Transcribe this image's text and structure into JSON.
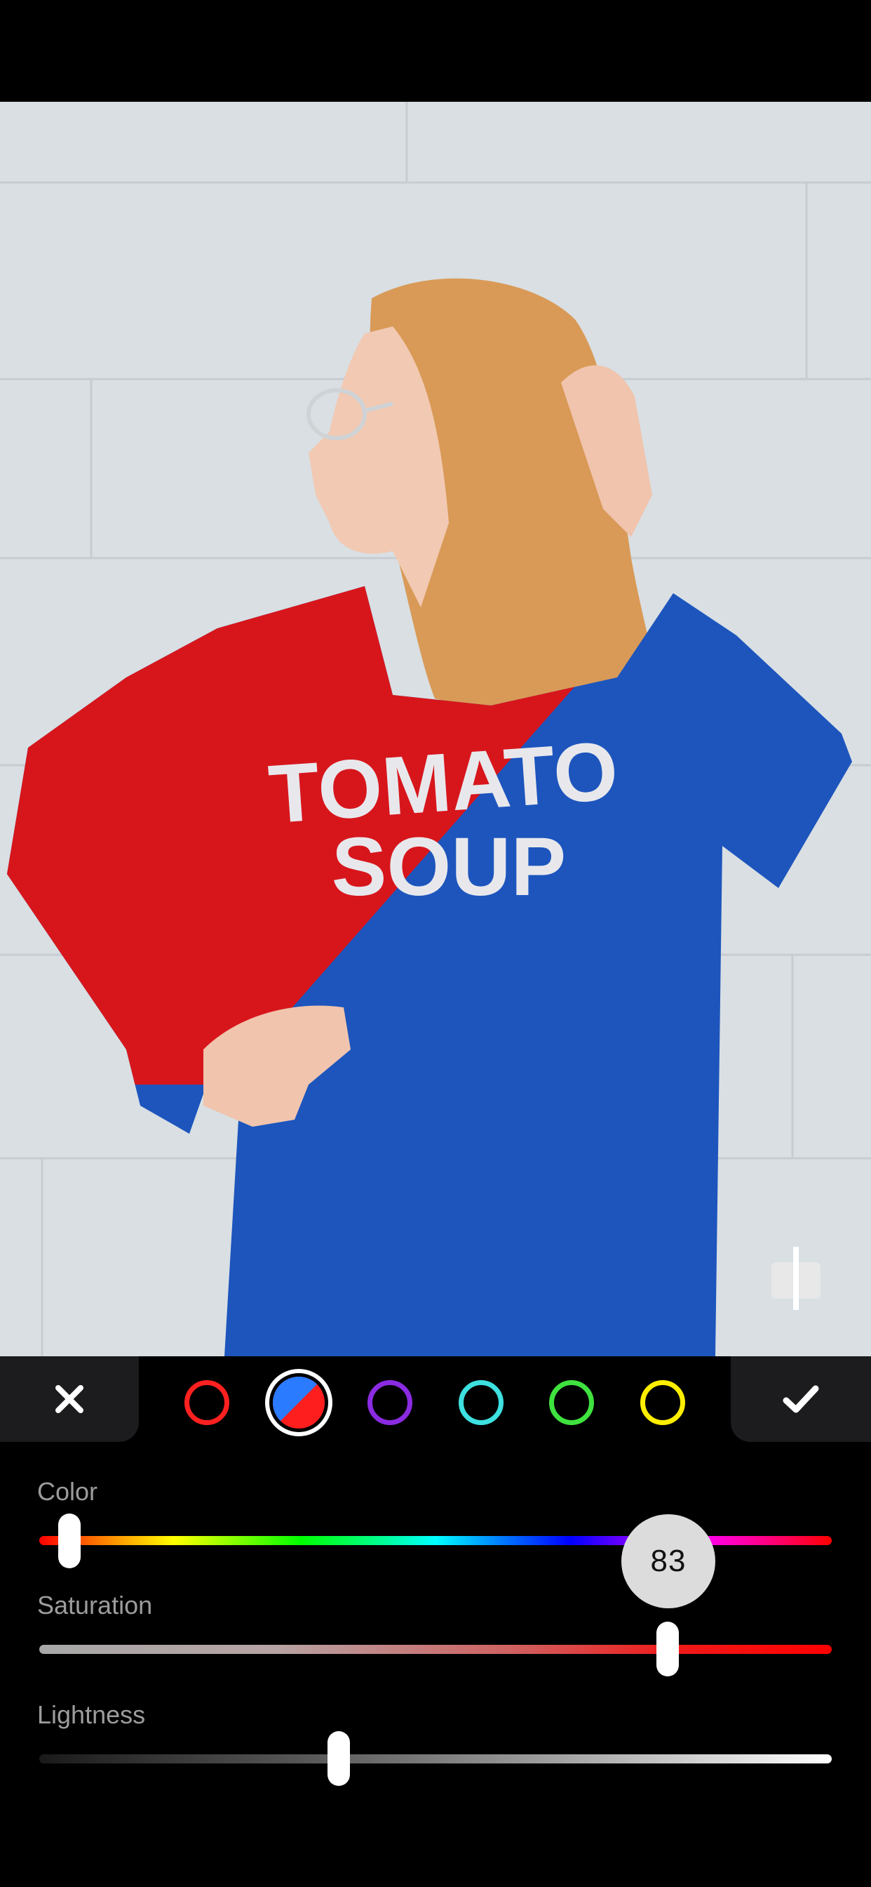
{
  "photo": {
    "description_icon": "photo-canvas",
    "shirt_text_line1": "TOMATO",
    "shirt_text_line2": "SOUP",
    "split_colors": {
      "left": "#d7161c",
      "right": "#1d55bd"
    }
  },
  "toolbar": {
    "cancel_icon": "close-icon",
    "confirm_icon": "checkmark-icon",
    "swatches": [
      {
        "name": "red",
        "color": "#ff2020"
      },
      {
        "name": "blue-red",
        "color": "#2a7bff",
        "selected": true
      },
      {
        "name": "purple",
        "color": "#8a2be2"
      },
      {
        "name": "cyan",
        "color": "#3ee0e0"
      },
      {
        "name": "green",
        "color": "#3fe23f"
      },
      {
        "name": "yellow",
        "color": "#ffee00"
      }
    ]
  },
  "sliders": {
    "color": {
      "label": "Color",
      "value_label": "83",
      "position_fraction": 0.04
    },
    "saturation": {
      "label": "Saturation",
      "position_fraction": 0.795
    },
    "lightness": {
      "label": "Lightness",
      "position_fraction": 0.377
    }
  },
  "compare_icon": "split-compare-icon"
}
